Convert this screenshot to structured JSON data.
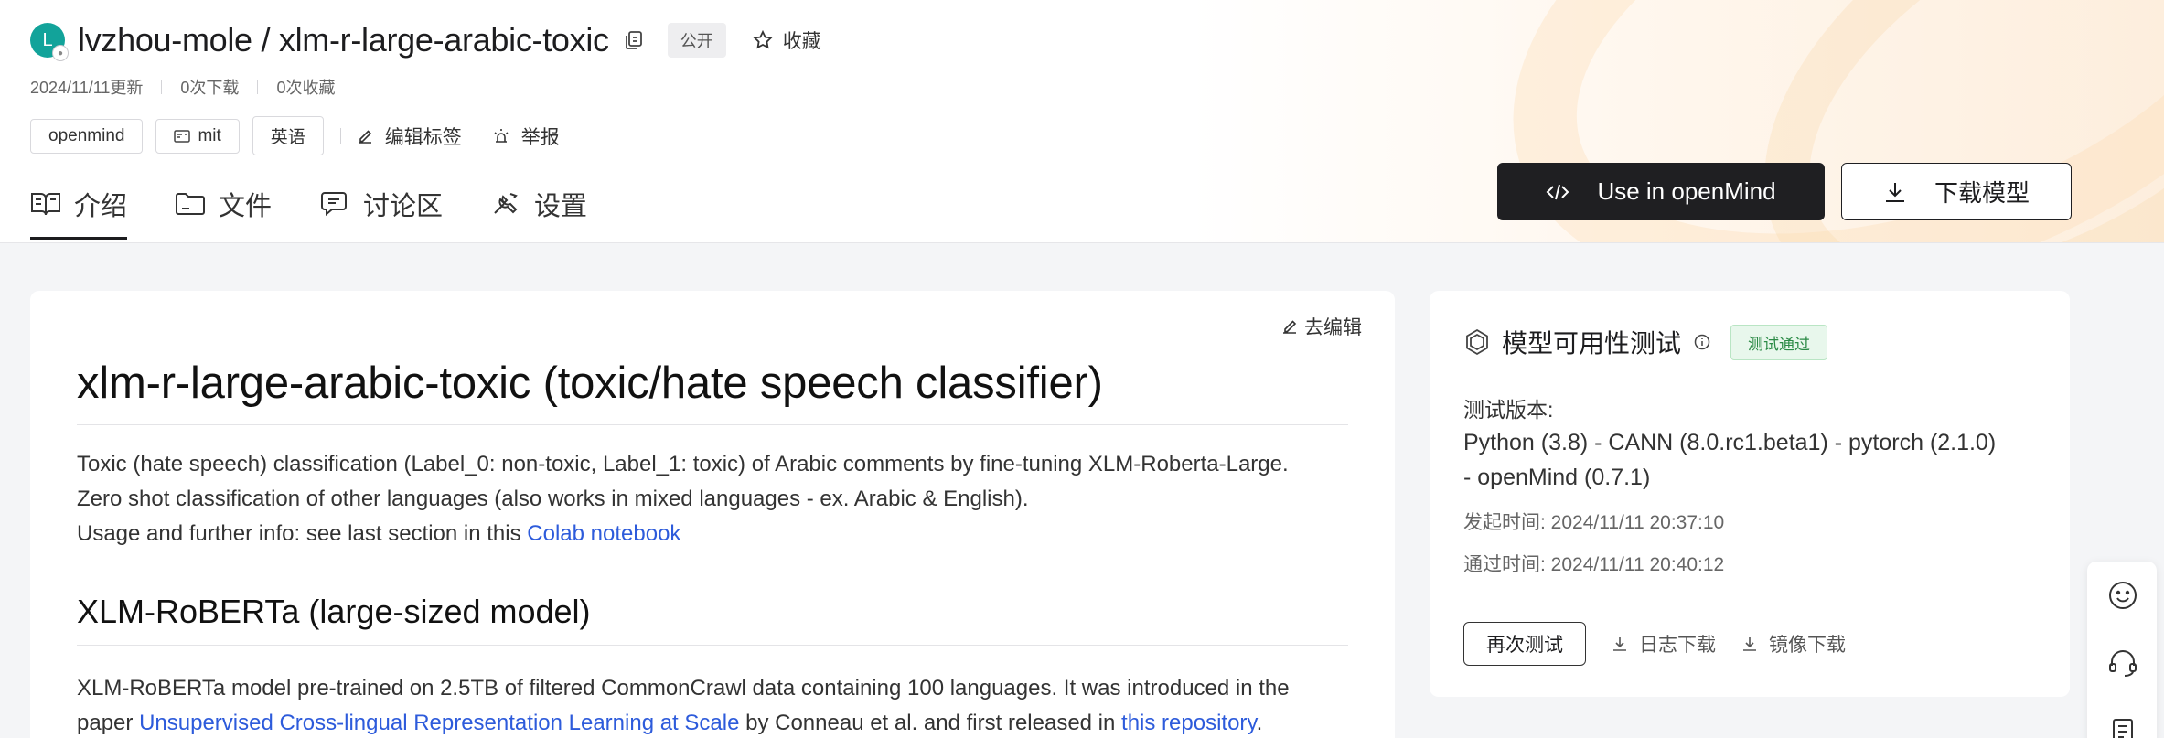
{
  "repo": {
    "avatar_letter": "L",
    "owner": "lvzhou-mole",
    "slash": "/",
    "name": "xlm-r-large-arabic-toxic",
    "visibility": "公开",
    "favorite_label": "收藏"
  },
  "meta": {
    "updated": "2024/11/11更新",
    "downloads": "0次下载",
    "favorites": "0次收藏"
  },
  "tags": {
    "items": [
      "openmind",
      "mit",
      "英语"
    ],
    "edit_tags": "编辑标签",
    "report": "举报"
  },
  "tabs": [
    "介绍",
    "文件",
    "讨论区",
    "设置"
  ],
  "actions": {
    "use_in": "Use in openMind",
    "download_model": "下载模型"
  },
  "readme": {
    "edit_label": "去编辑",
    "title": "xlm-r-large-arabic-toxic (toxic/hate speech classifier)",
    "p1_line1": "Toxic (hate speech) classification (Label_0: non-toxic, Label_1: toxic) of Arabic comments by fine-tuning XLM-Roberta-Large.",
    "p1_line2": "Zero shot classification of other languages (also works in mixed languages - ex. Arabic & English).",
    "p1_line3_prefix": "Usage and further info: see last section in this ",
    "p1_link": "Colab notebook",
    "h2": "XLM-RoBERTa (large-sized model)",
    "p2_a": "XLM-RoBERTa model pre-trained on 2.5TB of filtered CommonCrawl data containing 100 languages. It was introduced in the",
    "p2_b": "paper ",
    "p2_link1": "Unsupervised Cross-lingual Representation Learning at Scale",
    "p2_c": " by Conneau et al. and first released in ",
    "p2_link2": "this repository",
    "p2_d": "."
  },
  "availability": {
    "title": "模型可用性测试",
    "status": "测试通过",
    "version_label": "测试版本:",
    "version_line1": "Python (3.8) - CANN (8.0.rc1.beta1) - pytorch (2.1.0)",
    "version_line2": "- openMind (0.7.1)",
    "started": "发起时间: 2024/11/11 20:37:10",
    "passed": "通过时间: 2024/11/11 20:40:12",
    "retest": "再次测试",
    "log_download": "日志下载",
    "image_download": "镜像下载"
  },
  "colors": {
    "accent_link": "#2d5bdb",
    "avatar": "#12a39a",
    "dark_button": "#1f1f22",
    "pass_green": "#2a8a45"
  }
}
